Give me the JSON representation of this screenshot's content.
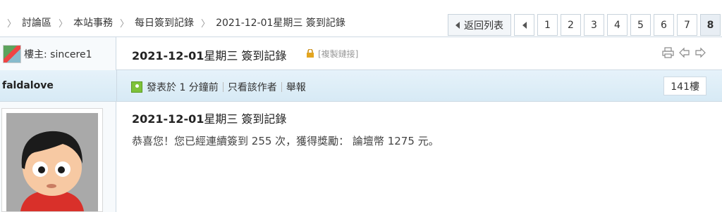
{
  "breadcrumb": [
    "討論區",
    "本站事務",
    "每日簽到記錄",
    "2021-12-01星期三 簽到記錄"
  ],
  "pager": {
    "back_label": "返回列表",
    "pages": [
      "1",
      "2",
      "3",
      "4",
      "5",
      "6",
      "7",
      "8"
    ],
    "current": "8"
  },
  "thread": {
    "op_label": "樓主: sincere1",
    "title_date": "2021-12-01",
    "title_rest": "星期三 簽到記錄",
    "copy_link": "[複製鏈接]"
  },
  "post": {
    "author": "faldalove",
    "posted": "發表於 1 分鐘前",
    "only_author": "只看該作者",
    "report": "舉報",
    "floor": "141樓",
    "title_date": "2021-12-01",
    "title_rest": "星期三 簽到記錄",
    "body": "恭喜您！您已經連續簽到 255 次，獲得獎勵： 論壇幣 1275 元。"
  },
  "icons": [
    "print-icon",
    "prev-thread-icon",
    "next-thread-icon",
    "lock-icon",
    "online-icon"
  ]
}
